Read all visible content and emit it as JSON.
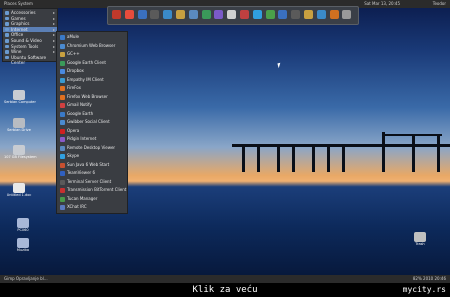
{
  "topbar": {
    "left_menu": "Places  System",
    "right_text": "Sat Mar 13, 20:45",
    "user": "Teodor"
  },
  "categories": [
    {
      "label": "Accessories",
      "has_sub": true
    },
    {
      "label": "Games",
      "has_sub": true
    },
    {
      "label": "Graphics",
      "has_sub": true
    },
    {
      "label": "Internet",
      "has_sub": true,
      "selected": true
    },
    {
      "label": "Office",
      "has_sub": true
    },
    {
      "label": "Sound & Video",
      "has_sub": true
    },
    {
      "label": "System Tools",
      "has_sub": true
    },
    {
      "label": "Wine",
      "has_sub": true
    },
    {
      "label": "Ubuntu Software Center",
      "has_sub": false
    }
  ],
  "internet_apps": [
    {
      "label": "aMule",
      "color": "#3a7ac8"
    },
    {
      "label": "Chromium Web Browser",
      "color": "#4a8ad0"
    },
    {
      "label": "GC++",
      "color": "#c8a040"
    },
    {
      "label": "Google Earth Client",
      "color": "#3a9a5a"
    },
    {
      "label": "Dropbox",
      "color": "#4a8ae0"
    },
    {
      "label": "Empathy IM Client",
      "color": "#3a9ad0"
    },
    {
      "label": "FireFox",
      "color": "#e07020"
    },
    {
      "label": "Firefox Web Browser",
      "color": "#e07020"
    },
    {
      "label": "Gmail Notify",
      "color": "#d04040"
    },
    {
      "label": "Google Earth",
      "color": "#3a7ac8"
    },
    {
      "label": "Gwibber Social Client",
      "color": "#4a8ad0"
    },
    {
      "label": "Opera",
      "color": "#d02020"
    },
    {
      "label": "Pidgin Internet",
      "color": "#8a5ac8"
    },
    {
      "label": "Remote Desktop Viewer",
      "color": "#5a8ac0"
    },
    {
      "label": "Skype",
      "color": "#30a0e0"
    },
    {
      "label": "Sun Java 6 Web Start",
      "color": "#c85030"
    },
    {
      "label": "TeamViewer 6",
      "color": "#3060c0"
    },
    {
      "label": "Terminal Server Client",
      "color": "#5a5a5a"
    },
    {
      "label": "Transmission BitTorrent Client",
      "color": "#c83030"
    },
    {
      "label": "Tucan Manager",
      "color": "#4a9a4a"
    },
    {
      "label": "XChat IRC",
      "color": "#5a7ac0"
    }
  ],
  "desktop_icons": [
    {
      "label": "Serbian Computer",
      "color": "#c8ccd2"
    },
    {
      "label": "Serbian Drive",
      "color": "#b8bcc2"
    },
    {
      "label": "107 GB Filesystem",
      "color": "#c8ccd2"
    },
    {
      "label": "Untitled 1.doc",
      "color": "#e8e8e8"
    },
    {
      "label": "PC060",
      "color": "#a8b8d8"
    },
    {
      "label": "Muzika",
      "color": "#a8b8d8"
    },
    {
      "label": "Trash",
      "color": "#c0c0c0"
    }
  ],
  "dock_colors": [
    "#c0392b",
    "#e74c3c",
    "#3a70c0",
    "#5a5a5a",
    "#3a8ac8",
    "#c8a040",
    "#5a8ac0",
    "#3a9a5a",
    "#7a5ac8",
    "#d0d0d0",
    "#c04040",
    "#30a0e0",
    "#4aa04a",
    "#3a70c0",
    "#5a5a5a",
    "#c8a040",
    "#3a8ac8",
    "#d07020",
    "#9a9a9a"
  ],
  "bottombar": {
    "left": "Gimp  Opravljanje bl...",
    "right": "82% 2010 20:46"
  },
  "caption": "Klik za veću",
  "watermark": "mycity.rs"
}
